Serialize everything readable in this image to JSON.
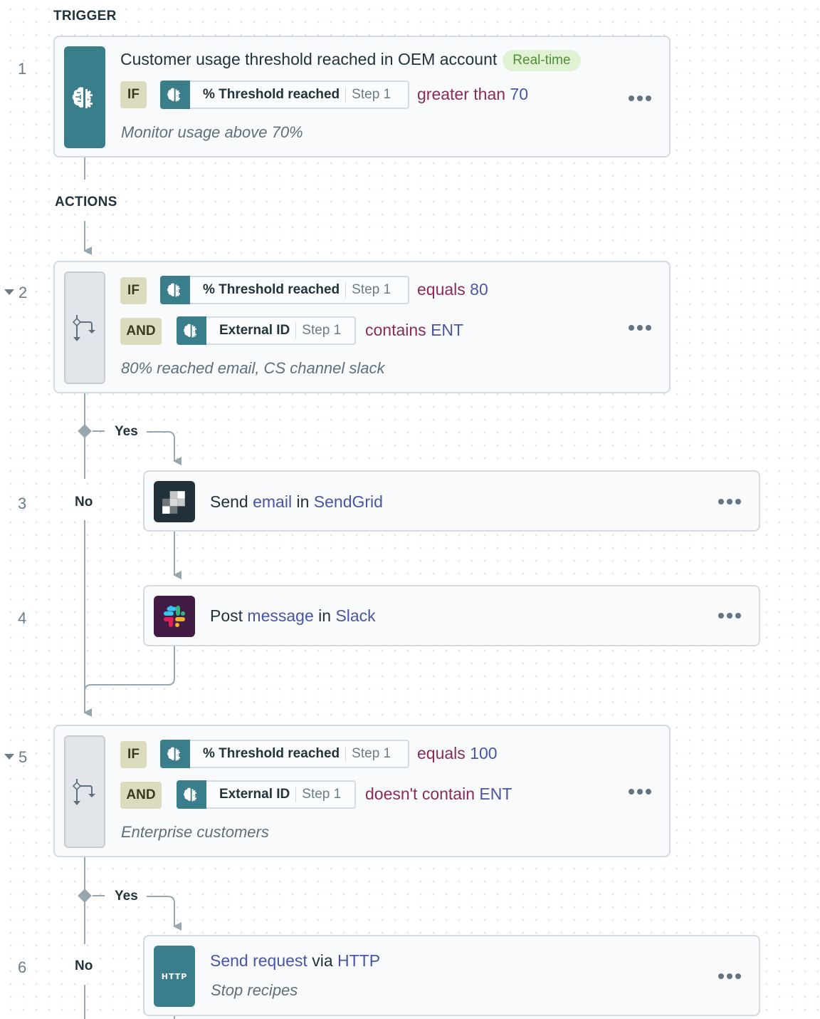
{
  "sections": {
    "trigger": "TRIGGER",
    "actions": "ACTIONS"
  },
  "colors": {
    "app_teal": "#3b7e8b",
    "operator": "#8a2b5a",
    "value_link": "#4a55a6",
    "realtime_badge_bg": "#e1f2d4",
    "realtime_badge_text": "#4d8f34",
    "keyword_bg": "#dcdbbe",
    "connector": "#98a6ae",
    "sendgrid_bg": "#22303a",
    "slack_bg": "#421b45"
  },
  "steps": [
    {
      "number": "1",
      "icon": "brain-gear-icon",
      "title": "Customer usage threshold reached in OEM account",
      "badge": "Real-time",
      "conditions": [
        {
          "keyword": "IF",
          "field": "% Threshold reached",
          "step": "Step 1",
          "operator": "greater than",
          "value": "70"
        }
      ],
      "description": "Monitor usage above 70%",
      "menu": "more-options"
    },
    {
      "number": "2",
      "collapsible": true,
      "icon": "branch-icon",
      "conditions": [
        {
          "keyword": "IF",
          "field": "% Threshold reached",
          "step": "Step 1",
          "operator": "equals",
          "value": "80"
        },
        {
          "keyword": "AND",
          "field": "External ID",
          "step": "Step 1",
          "operator": "contains",
          "value": "ENT"
        }
      ],
      "description": "80% reached email, CS channel slack",
      "branch_yes": "Yes",
      "branch_no": "No"
    },
    {
      "number": "3",
      "icon": "sendgrid-icon",
      "verb": "Send",
      "object": "email",
      "prep": "in",
      "app": "SendGrid"
    },
    {
      "number": "4",
      "icon": "slack-icon",
      "verb": "Post",
      "object": "message",
      "prep": "in",
      "app": "Slack"
    },
    {
      "number": "5",
      "collapsible": true,
      "icon": "branch-icon",
      "conditions": [
        {
          "keyword": "IF",
          "field": "% Threshold reached",
          "step": "Step 1",
          "operator": "equals",
          "value": "100"
        },
        {
          "keyword": "AND",
          "field": "External ID",
          "step": "Step 1",
          "operator": "doesn't contain",
          "value": "ENT"
        }
      ],
      "description": "Enterprise customers",
      "branch_yes": "Yes",
      "branch_no": "No"
    },
    {
      "number": "6",
      "icon": "http-icon",
      "icon_label": "HTTP",
      "verb": "",
      "object": "Send request",
      "prep": "via",
      "app": "HTTP",
      "description": "Stop recipes"
    }
  ]
}
